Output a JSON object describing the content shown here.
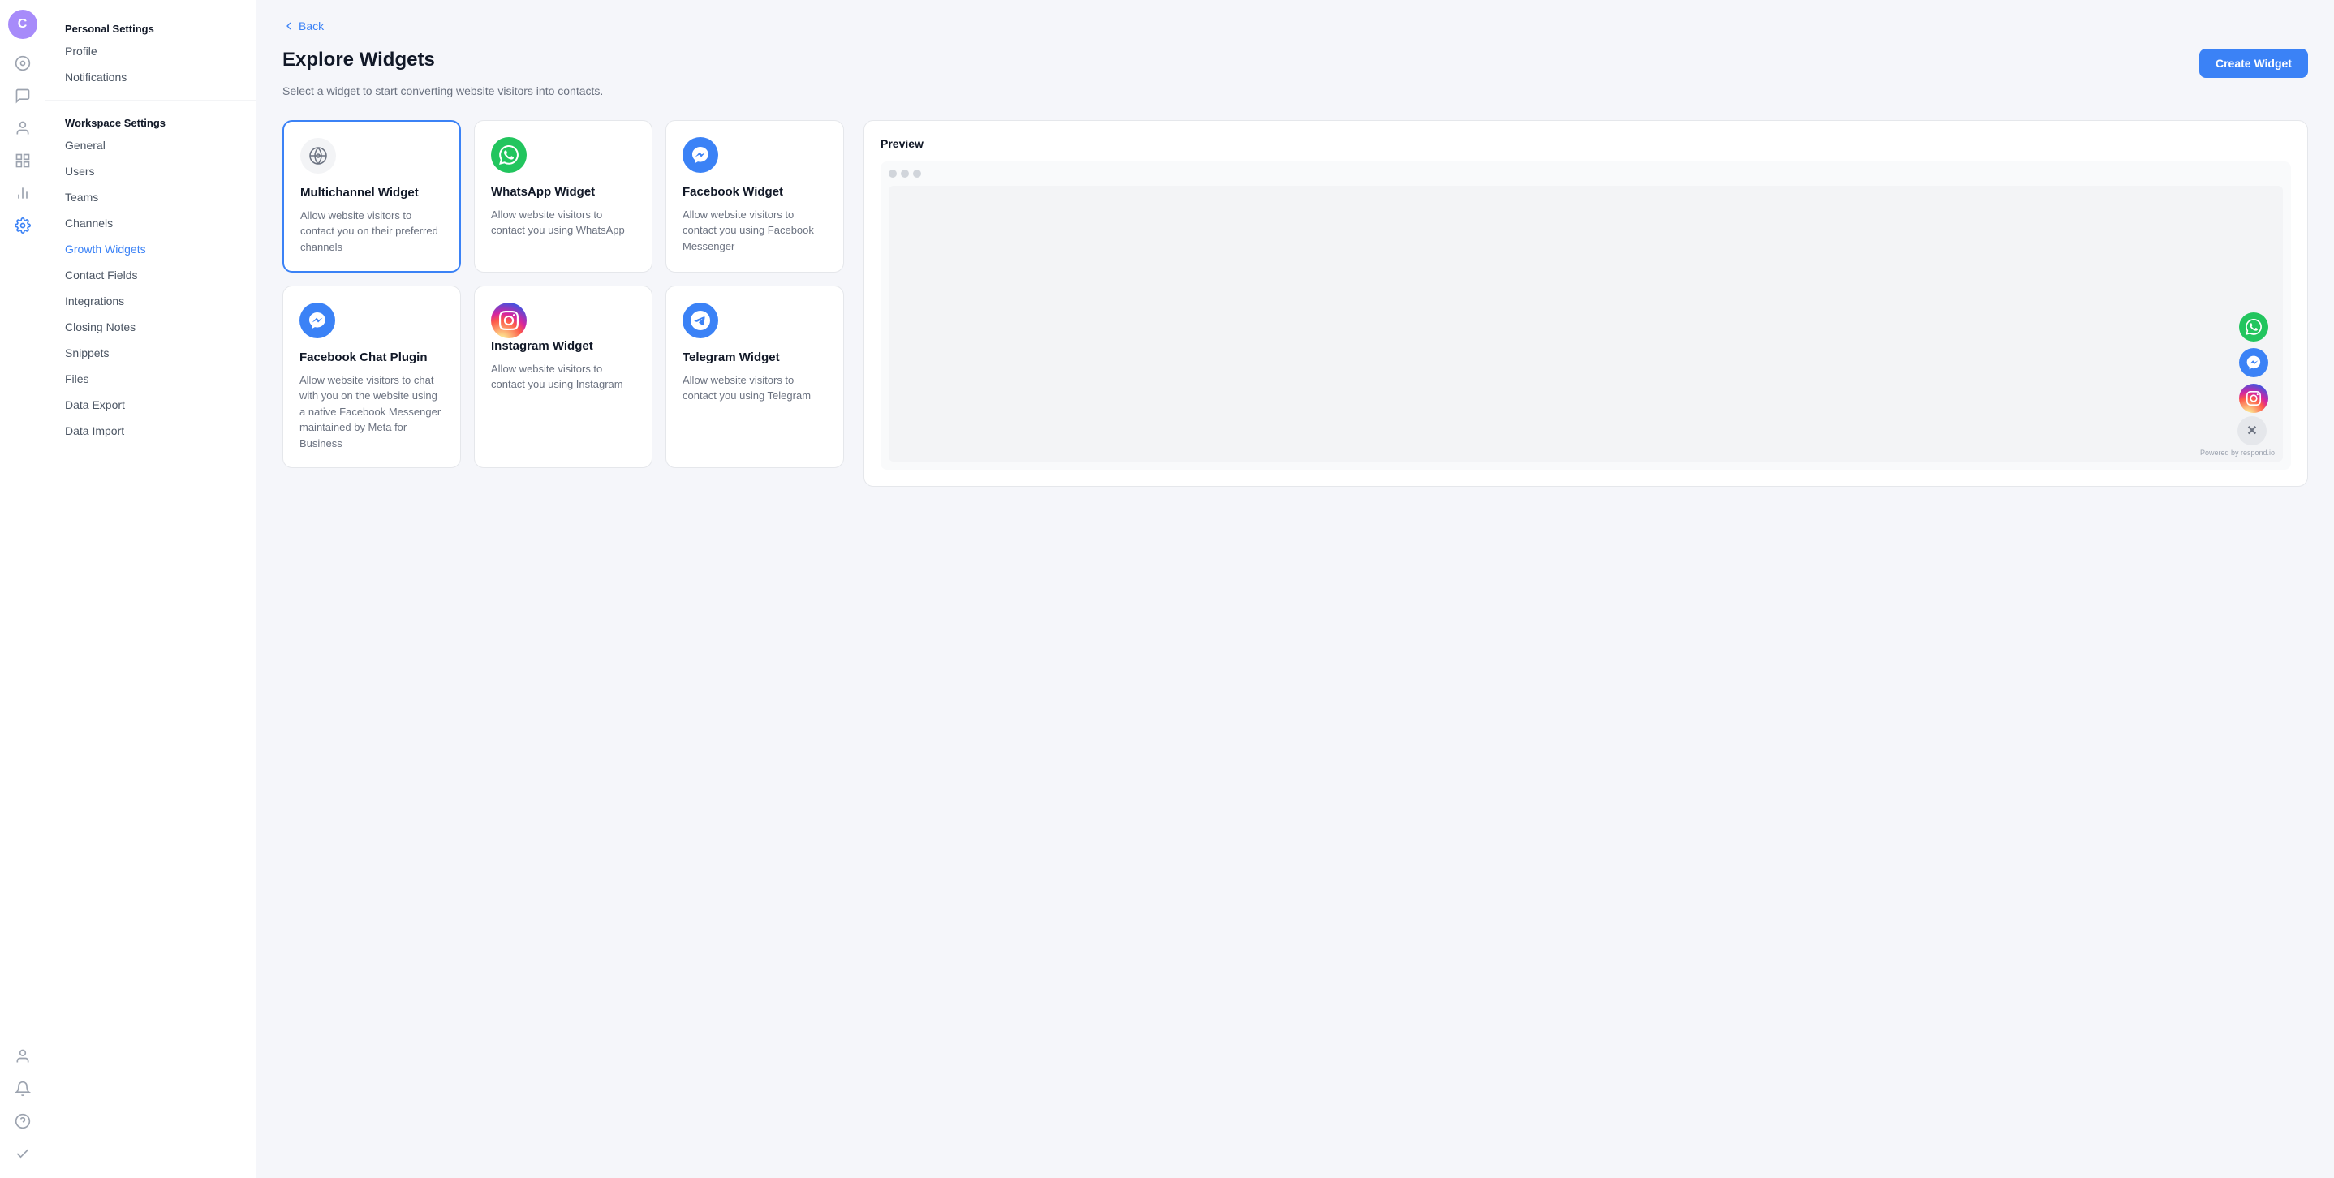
{
  "sidebar": {
    "avatar_label": "C",
    "avatar_color": "#a78bfa",
    "icons": [
      {
        "name": "dashboard-icon",
        "symbol": "⊙"
      },
      {
        "name": "inbox-icon",
        "symbol": "💬"
      },
      {
        "name": "contacts-icon",
        "symbol": "👤"
      },
      {
        "name": "channels-icon",
        "symbol": "⊞"
      },
      {
        "name": "reports-icon",
        "symbol": "📊"
      },
      {
        "name": "settings-icon",
        "symbol": "⚙",
        "active": true
      }
    ],
    "bottom_icons": [
      {
        "name": "user-profile-icon",
        "symbol": "👤"
      },
      {
        "name": "notifications-bell-icon",
        "symbol": "🔔"
      },
      {
        "name": "help-icon",
        "symbol": "❓"
      },
      {
        "name": "check-icon",
        "symbol": "✔"
      }
    ]
  },
  "nav": {
    "personal_settings_label": "Personal Settings",
    "personal_items": [
      {
        "key": "profile",
        "label": "Profile",
        "active": false
      },
      {
        "key": "notifications",
        "label": "Notifications",
        "active": false
      }
    ],
    "workspace_settings_label": "Workspace Settings",
    "workspace_items": [
      {
        "key": "general",
        "label": "General",
        "active": false
      },
      {
        "key": "users",
        "label": "Users",
        "active": false
      },
      {
        "key": "teams",
        "label": "Teams",
        "active": false
      },
      {
        "key": "channels",
        "label": "Channels",
        "active": false
      },
      {
        "key": "growth-widgets",
        "label": "Growth Widgets",
        "active": true
      },
      {
        "key": "contact-fields",
        "label": "Contact Fields",
        "active": false
      },
      {
        "key": "integrations",
        "label": "Integrations",
        "active": false
      },
      {
        "key": "closing-notes",
        "label": "Closing Notes",
        "active": false
      },
      {
        "key": "snippets",
        "label": "Snippets",
        "active": false
      },
      {
        "key": "files",
        "label": "Files",
        "active": false
      },
      {
        "key": "data-export",
        "label": "Data Export",
        "active": false
      },
      {
        "key": "data-import",
        "label": "Data Import",
        "active": false
      }
    ]
  },
  "main": {
    "back_label": "Back",
    "page_title": "Explore Widgets",
    "page_subtitle": "Select a widget to start converting website visitors into contacts.",
    "create_button_label": "Create Widget",
    "widgets": [
      {
        "key": "multichannel",
        "title": "Multichannel Widget",
        "description": "Allow website visitors to contact you on their preferred channels",
        "icon_type": "multichannel",
        "selected": true
      },
      {
        "key": "whatsapp",
        "title": "WhatsApp Widget",
        "description": "Allow website visitors to contact you using WhatsApp",
        "icon_type": "whatsapp",
        "selected": false
      },
      {
        "key": "facebook",
        "title": "Facebook Widget",
        "description": "Allow website visitors to contact you using Facebook Messenger",
        "icon_type": "facebook",
        "selected": false
      },
      {
        "key": "fbchat",
        "title": "Facebook Chat Plugin",
        "description": "Allow website visitors to chat with you on the website using a native Facebook Messenger maintained by Meta for Business",
        "icon_type": "fbchat",
        "selected": false
      },
      {
        "key": "instagram",
        "title": "Instagram Widget",
        "description": "Allow website visitors to contact you using Instagram",
        "icon_type": "instagram",
        "selected": false
      },
      {
        "key": "telegram",
        "title": "Telegram Widget",
        "description": "Allow website visitors to contact you using Telegram",
        "icon_type": "telegram",
        "selected": false
      }
    ],
    "preview": {
      "label": "Preview",
      "powered_by": "Powered by respond.io"
    }
  }
}
